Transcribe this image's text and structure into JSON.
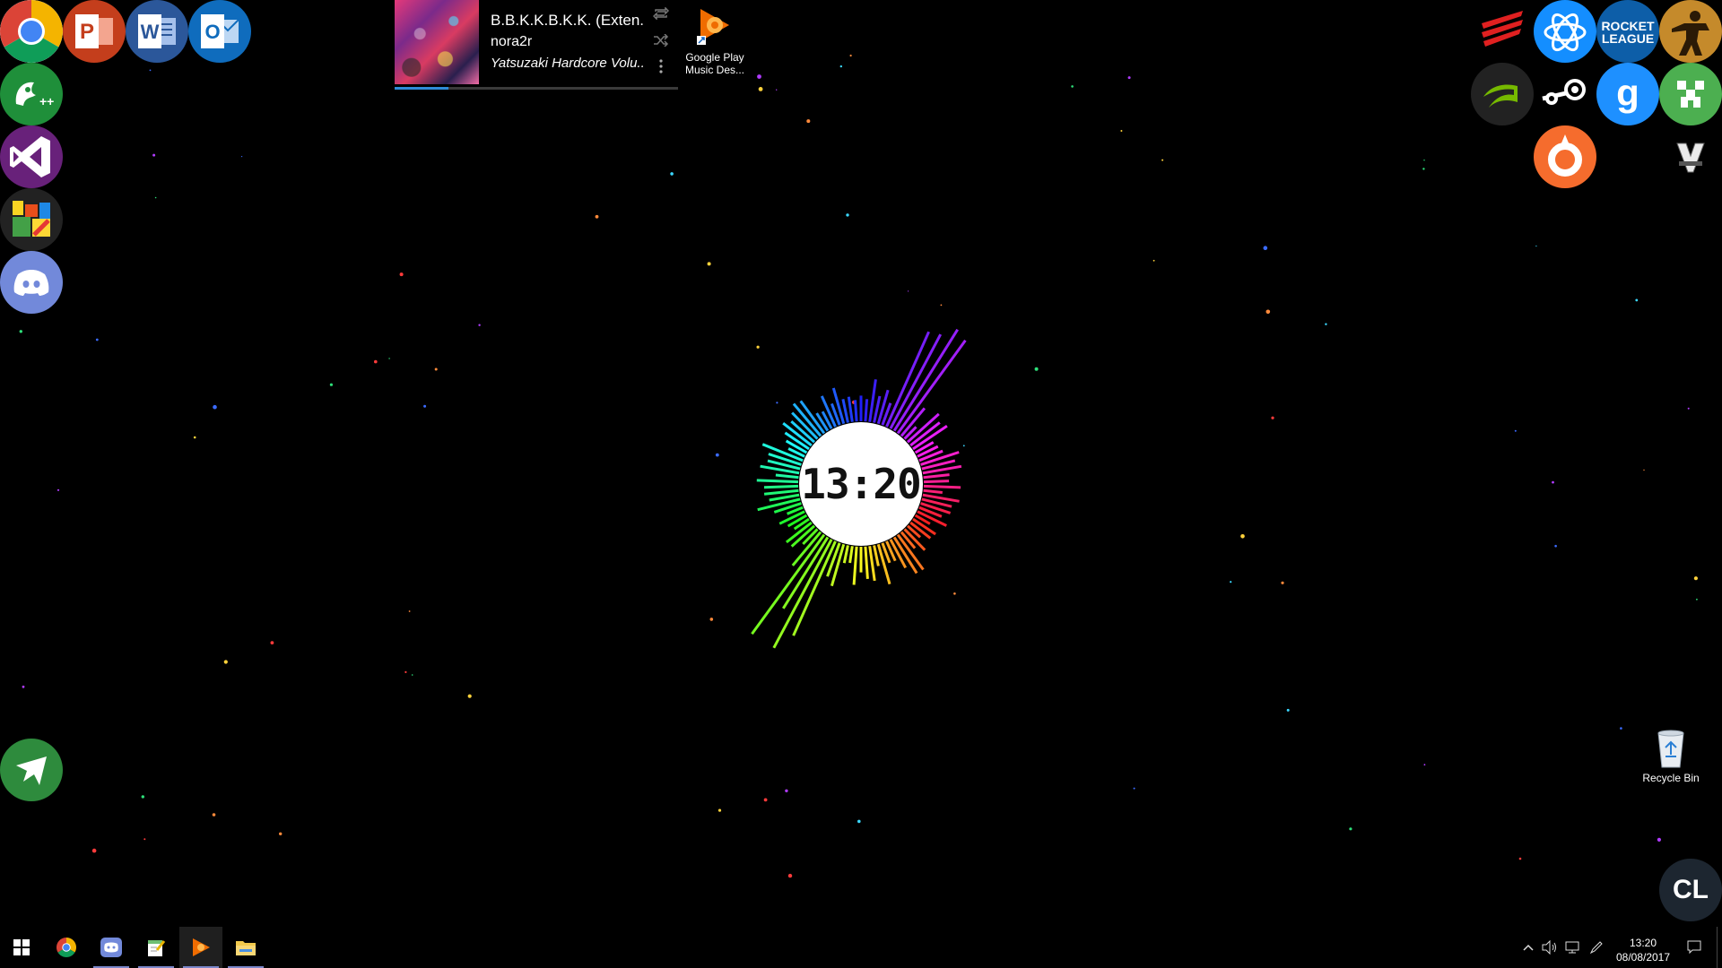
{
  "colors": {
    "chrome_red": "#db4437",
    "chrome_yellow": "#f4b400",
    "chrome_green": "#0f9d58",
    "chrome_blue": "#4285f4",
    "powerpoint": "#c43e1c",
    "word": "#2b579a",
    "outlook": "#0f6cbd",
    "notepadpp": "#1f8f3a",
    "visual_studio": "#68217a",
    "discord": "#7289da",
    "battlenet": "#148eff",
    "rocket_league": "#0d5ea8",
    "csgo": "#c58a2b",
    "nvidia": "#76b900",
    "gmod": "#1e90ff",
    "origin": "#f56c2d",
    "progress": "#2e8bd8"
  },
  "left_dock": [
    {
      "name": "chrome-icon",
      "label": "Chrome"
    },
    {
      "name": "powerpoint-icon",
      "label": "P"
    },
    {
      "name": "word-icon",
      "label": "W"
    },
    {
      "name": "outlook-icon",
      "label": "O"
    },
    {
      "name": "notepad-plus-plus-icon",
      "label": "++"
    },
    {
      "name": "visual-studio-icon",
      "label": "Visual Studio"
    },
    {
      "name": "avg-icon",
      "label": "AVG"
    },
    {
      "name": "discord-icon",
      "label": "Discord"
    },
    {
      "name": "airplane-icon",
      "label": "Airplane"
    }
  ],
  "right_dock": [
    {
      "name": "madcatz-icon",
      "label": "Mad Catz"
    },
    {
      "name": "battlenet-icon",
      "label": "Battle.net"
    },
    {
      "name": "rocket-league-icon",
      "label": "ROCKET LEAGUE"
    },
    {
      "name": "csgo-icon",
      "label": "CS:GO"
    },
    {
      "name": "nvidia-icon",
      "label": "NVIDIA"
    },
    {
      "name": "steam-icon",
      "label": "Steam"
    },
    {
      "name": "gmod-icon",
      "label": "g"
    },
    {
      "name": "minecraft-icon",
      "label": "Minecraft"
    },
    {
      "name": "origin-icon",
      "label": "Origin"
    },
    {
      "name": "gta5-icon",
      "label": "V"
    }
  ],
  "media": {
    "title": "B.B.K.K.B.K.K. (Exten...",
    "artist": "nora2r",
    "album": "Yatsuzaki Hardcore Volu...",
    "progress": 0.19,
    "repeat_icon": "repeat-icon",
    "shuffle_icon": "shuffle-icon",
    "more_icon": "more-icon"
  },
  "shortcuts": {
    "google_play": {
      "line1": "Google Play",
      "line2": "Music Des..."
    },
    "recycle_bin": {
      "label": "Recycle Bin"
    }
  },
  "clock": {
    "time": "13:20"
  },
  "corner_logo": {
    "text": "CL"
  },
  "taskbar": {
    "apps": [
      {
        "name": "start-button",
        "icon": "windows-icon"
      },
      {
        "name": "taskbar-chrome",
        "icon": "chrome-icon"
      },
      {
        "name": "taskbar-discord",
        "icon": "discord-icon"
      },
      {
        "name": "taskbar-notepadpp",
        "icon": "notepad-plus-plus-icon"
      },
      {
        "name": "taskbar-google-play-music",
        "icon": "google-play-music-icon"
      },
      {
        "name": "taskbar-file-explorer",
        "icon": "folder-icon"
      }
    ],
    "tray": {
      "time": "13:20",
      "date": "08/08/2017"
    }
  }
}
